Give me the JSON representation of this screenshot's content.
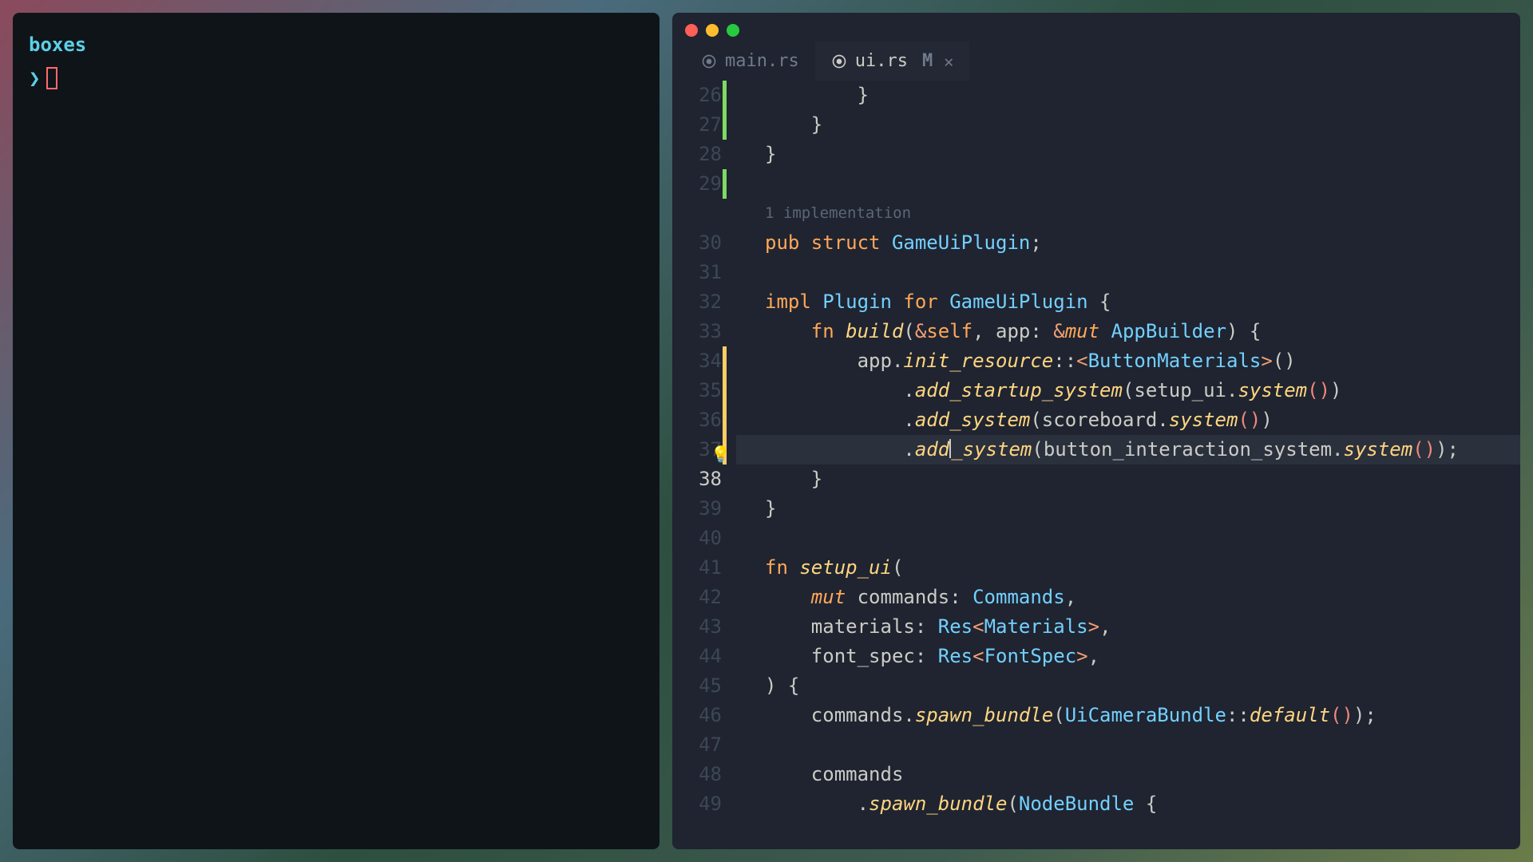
{
  "terminal": {
    "title": "boxes",
    "prompt_symbol": "❯"
  },
  "editor": {
    "tabs": [
      {
        "label": "main.rs",
        "active": false,
        "modified": false,
        "icon": "rust-icon"
      },
      {
        "label": "ui.rs",
        "active": true,
        "modified": true,
        "modified_indicator": "M",
        "icon": "rust-icon"
      }
    ],
    "codelens": "1 implementation",
    "lines": [
      {
        "num": 26,
        "change": "green",
        "indent": 2,
        "tokens": [
          [
            "punct",
            "        }"
          ]
        ]
      },
      {
        "num": 27,
        "change": "green",
        "indent": 1,
        "tokens": [
          [
            "punct",
            "    }"
          ]
        ]
      },
      {
        "num": 28,
        "change": null,
        "indent": 0,
        "tokens": [
          [
            "punct",
            "}"
          ]
        ]
      },
      {
        "num": 29,
        "change": "green",
        "indent": 0,
        "tokens": []
      },
      {
        "num": "lens",
        "change": null,
        "indent": 0,
        "tokens": []
      },
      {
        "num": 30,
        "change": null,
        "indent": 0,
        "tokens": [
          [
            "kw",
            "pub "
          ],
          [
            "kw",
            "struct "
          ],
          [
            "type",
            "GameUiPlugin"
          ],
          [
            "punct",
            ";"
          ]
        ]
      },
      {
        "num": 31,
        "change": null,
        "indent": 0,
        "tokens": []
      },
      {
        "num": 32,
        "change": null,
        "indent": 0,
        "tokens": [
          [
            "kw",
            "impl "
          ],
          [
            "type",
            "Plugin"
          ],
          [
            "kw2",
            " for "
          ],
          [
            "type",
            "GameUiPlugin "
          ],
          [
            "punct",
            "{"
          ]
        ]
      },
      {
        "num": 33,
        "change": null,
        "indent": 1,
        "tokens": [
          [
            "kw",
            "    fn "
          ],
          [
            "fn-name",
            "build"
          ],
          [
            "punct",
            "("
          ],
          [
            "op",
            "&"
          ],
          [
            "kw",
            "self"
          ],
          [
            "punct",
            ", "
          ],
          [
            "param",
            "app"
          ],
          [
            "punct",
            ": "
          ],
          [
            "op",
            "&"
          ],
          [
            "mut",
            "mut "
          ],
          [
            "type",
            "AppBuilder"
          ],
          [
            "punct",
            ") {"
          ]
        ]
      },
      {
        "num": 34,
        "change": "yellow",
        "indent": 2,
        "tokens": [
          [
            "ident",
            "        app"
          ],
          [
            "punct",
            "."
          ],
          [
            "method",
            "init_resource"
          ],
          [
            "punct",
            "::"
          ],
          [
            "op",
            "<"
          ],
          [
            "type",
            "ButtonMaterials"
          ],
          [
            "op",
            ">"
          ],
          [
            "punct",
            "()"
          ]
        ]
      },
      {
        "num": 35,
        "change": "yellow",
        "indent": 3,
        "tokens": [
          [
            "punct",
            "            ."
          ],
          [
            "method",
            "add_startup_system"
          ],
          [
            "punct",
            "("
          ],
          [
            "ident",
            "setup_ui"
          ],
          [
            "punct",
            "."
          ],
          [
            "method",
            "system"
          ],
          [
            "paren-empty",
            "()"
          ],
          [
            "punct",
            ")"
          ]
        ]
      },
      {
        "num": 36,
        "change": "yellow",
        "indent": 3,
        "tokens": [
          [
            "punct",
            "            ."
          ],
          [
            "method",
            "add_system"
          ],
          [
            "punct",
            "("
          ],
          [
            "ident",
            "scoreboard"
          ],
          [
            "punct",
            "."
          ],
          [
            "method",
            "system"
          ],
          [
            "paren-empty",
            "()"
          ],
          [
            "punct",
            ")"
          ]
        ]
      },
      {
        "num": 37,
        "change": "yellow",
        "indent": 3,
        "highlighted": true,
        "bulb": true,
        "cursor_after": 4,
        "tokens": [
          [
            "punct",
            "            ."
          ],
          [
            "method",
            "add"
          ],
          [
            "cursor",
            ""
          ],
          [
            "method",
            "_system"
          ],
          [
            "punct",
            "("
          ],
          [
            "ident",
            "button_interaction_system"
          ],
          [
            "punct",
            "."
          ],
          [
            "method",
            "system"
          ],
          [
            "paren-empty",
            "()"
          ],
          [
            "punct",
            ");"
          ]
        ]
      },
      {
        "num": 38,
        "change": null,
        "current": true,
        "indent": 1,
        "tokens": [
          [
            "punct",
            "    }"
          ]
        ]
      },
      {
        "num": 39,
        "change": null,
        "indent": 0,
        "tokens": [
          [
            "punct",
            "}"
          ]
        ]
      },
      {
        "num": 40,
        "change": null,
        "indent": 0,
        "tokens": []
      },
      {
        "num": 41,
        "change": null,
        "indent": 0,
        "tokens": [
          [
            "kw",
            "fn "
          ],
          [
            "fn-name",
            "setup_ui"
          ],
          [
            "punct",
            "("
          ]
        ]
      },
      {
        "num": 42,
        "change": null,
        "indent": 1,
        "tokens": [
          [
            "mut",
            "    mut "
          ],
          [
            "param",
            "commands"
          ],
          [
            "punct",
            ": "
          ],
          [
            "type",
            "Commands"
          ],
          [
            "punct",
            ","
          ]
        ]
      },
      {
        "num": 43,
        "change": null,
        "indent": 1,
        "tokens": [
          [
            "param",
            "    materials"
          ],
          [
            "punct",
            ": "
          ],
          [
            "type",
            "Res"
          ],
          [
            "op",
            "<"
          ],
          [
            "type",
            "Materials"
          ],
          [
            "op",
            ">"
          ],
          [
            "punct",
            ","
          ]
        ]
      },
      {
        "num": 44,
        "change": null,
        "indent": 1,
        "tokens": [
          [
            "param",
            "    font_spec"
          ],
          [
            "punct",
            ": "
          ],
          [
            "type",
            "Res"
          ],
          [
            "op",
            "<"
          ],
          [
            "type",
            "FontSpec"
          ],
          [
            "op",
            ">"
          ],
          [
            "punct",
            ","
          ]
        ]
      },
      {
        "num": 45,
        "change": null,
        "indent": 0,
        "tokens": [
          [
            "punct",
            ") {"
          ]
        ]
      },
      {
        "num": 46,
        "change": null,
        "indent": 1,
        "tokens": [
          [
            "ident",
            "    commands"
          ],
          [
            "punct",
            "."
          ],
          [
            "method",
            "spawn_bundle"
          ],
          [
            "punct",
            "("
          ],
          [
            "type",
            "UiCameraBundle"
          ],
          [
            "punct",
            "::"
          ],
          [
            "method",
            "default"
          ],
          [
            "paren-empty",
            "()"
          ],
          [
            "punct",
            ");"
          ]
        ]
      },
      {
        "num": 47,
        "change": null,
        "indent": 0,
        "tokens": []
      },
      {
        "num": 48,
        "change": null,
        "indent": 1,
        "tokens": [
          [
            "ident",
            "    commands"
          ]
        ]
      },
      {
        "num": 49,
        "change": null,
        "indent": 2,
        "tokens": [
          [
            "punct",
            "        ."
          ],
          [
            "method",
            "spawn_bundle"
          ],
          [
            "punct",
            "("
          ],
          [
            "type",
            "NodeBundle "
          ],
          [
            "punct",
            "{"
          ]
        ]
      }
    ]
  }
}
